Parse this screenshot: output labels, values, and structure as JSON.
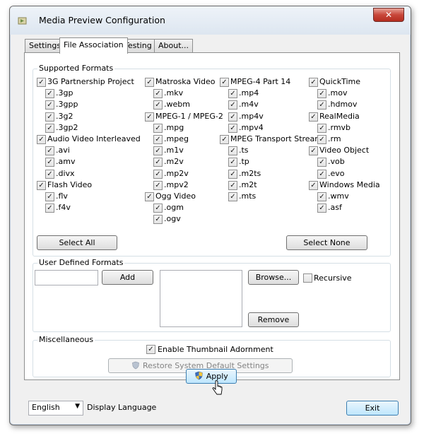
{
  "window": {
    "title": "Media Preview Configuration",
    "close_label": "✕"
  },
  "tabs": [
    {
      "label": "Settings"
    },
    {
      "label": "File Association"
    },
    {
      "label": "Testing"
    },
    {
      "label": "About..."
    }
  ],
  "supported_formats": {
    "label": "Supported Formats",
    "columns": [
      [
        {
          "type": "group",
          "label": "3G Partnership Project",
          "checked": true
        },
        {
          "type": "ext",
          "label": ".3gp",
          "checked": true
        },
        {
          "type": "ext",
          "label": ".3gpp",
          "checked": true
        },
        {
          "type": "ext",
          "label": ".3g2",
          "checked": true
        },
        {
          "type": "ext",
          "label": ".3gp2",
          "checked": true
        },
        {
          "type": "group",
          "label": "Audio Video Interleaved",
          "checked": true
        },
        {
          "type": "ext",
          "label": ".avi",
          "checked": true
        },
        {
          "type": "ext",
          "label": ".amv",
          "checked": true
        },
        {
          "type": "ext",
          "label": ".divx",
          "checked": true
        },
        {
          "type": "group",
          "label": "Flash Video",
          "checked": true
        },
        {
          "type": "ext",
          "label": ".flv",
          "checked": true
        },
        {
          "type": "ext",
          "label": ".f4v",
          "checked": true
        }
      ],
      [
        {
          "type": "group",
          "label": "Matroska Video",
          "checked": true
        },
        {
          "type": "ext",
          "label": ".mkv",
          "checked": true
        },
        {
          "type": "ext",
          "label": ".webm",
          "checked": true
        },
        {
          "type": "group",
          "label": "MPEG-1 / MPEG-2",
          "checked": true
        },
        {
          "type": "ext",
          "label": ".mpg",
          "checked": true
        },
        {
          "type": "ext",
          "label": ".mpeg",
          "checked": true
        },
        {
          "type": "ext",
          "label": ".m1v",
          "checked": true
        },
        {
          "type": "ext",
          "label": ".m2v",
          "checked": true
        },
        {
          "type": "ext",
          "label": ".mp2v",
          "checked": true
        },
        {
          "type": "ext",
          "label": ".mpv2",
          "checked": true
        },
        {
          "type": "group",
          "label": "Ogg Video",
          "checked": true
        },
        {
          "type": "ext",
          "label": ".ogm",
          "checked": true
        },
        {
          "type": "ext",
          "label": ".ogv",
          "checked": true
        }
      ],
      [
        {
          "type": "group",
          "label": "MPEG-4 Part 14",
          "checked": true
        },
        {
          "type": "ext",
          "label": ".mp4",
          "checked": true
        },
        {
          "type": "ext",
          "label": ".m4v",
          "checked": true
        },
        {
          "type": "ext",
          "label": ".mp4v",
          "checked": true
        },
        {
          "type": "ext",
          "label": ".mpv4",
          "checked": true
        },
        {
          "type": "group",
          "label": "MPEG Transport Stream",
          "checked": true
        },
        {
          "type": "ext",
          "label": ".ts",
          "checked": true
        },
        {
          "type": "ext",
          "label": ".tp",
          "checked": true
        },
        {
          "type": "ext",
          "label": ".m2ts",
          "checked": true
        },
        {
          "type": "ext",
          "label": ".m2t",
          "checked": true
        },
        {
          "type": "ext",
          "label": ".mts",
          "checked": true
        }
      ],
      [
        {
          "type": "group",
          "label": "QuickTime",
          "checked": true
        },
        {
          "type": "ext",
          "label": ".mov",
          "checked": true
        },
        {
          "type": "ext",
          "label": ".hdmov",
          "checked": true
        },
        {
          "type": "group",
          "label": "RealMedia",
          "checked": true
        },
        {
          "type": "ext",
          "label": ".rmvb",
          "checked": true
        },
        {
          "type": "ext",
          "label": ".rm",
          "checked": true
        },
        {
          "type": "group",
          "label": "Video Object",
          "checked": true
        },
        {
          "type": "ext",
          "label": ".vob",
          "checked": true
        },
        {
          "type": "ext",
          "label": ".evo",
          "checked": true
        },
        {
          "type": "group",
          "label": "Windows Media",
          "checked": true
        },
        {
          "type": "ext",
          "label": ".wmv",
          "checked": true
        },
        {
          "type": "ext",
          "label": ".asf",
          "checked": true
        }
      ]
    ],
    "select_all_label": "Select All",
    "select_none_label": "Select None"
  },
  "user_defined": {
    "label": "User Defined Formats",
    "input_value": "",
    "add_label": "Add",
    "browse_label": "Browse...",
    "recursive_label": "Recursive",
    "recursive_checked": false,
    "remove_label": "Remove"
  },
  "misc": {
    "label": "Miscellaneous",
    "thumbnail_label": "Enable Thumbnail Adornment",
    "thumbnail_checked": true,
    "restore_label": "Restore System Default Settings"
  },
  "apply_label": "Apply",
  "language": {
    "selected": "English",
    "label": "Display Language"
  },
  "exit_label": "Exit"
}
